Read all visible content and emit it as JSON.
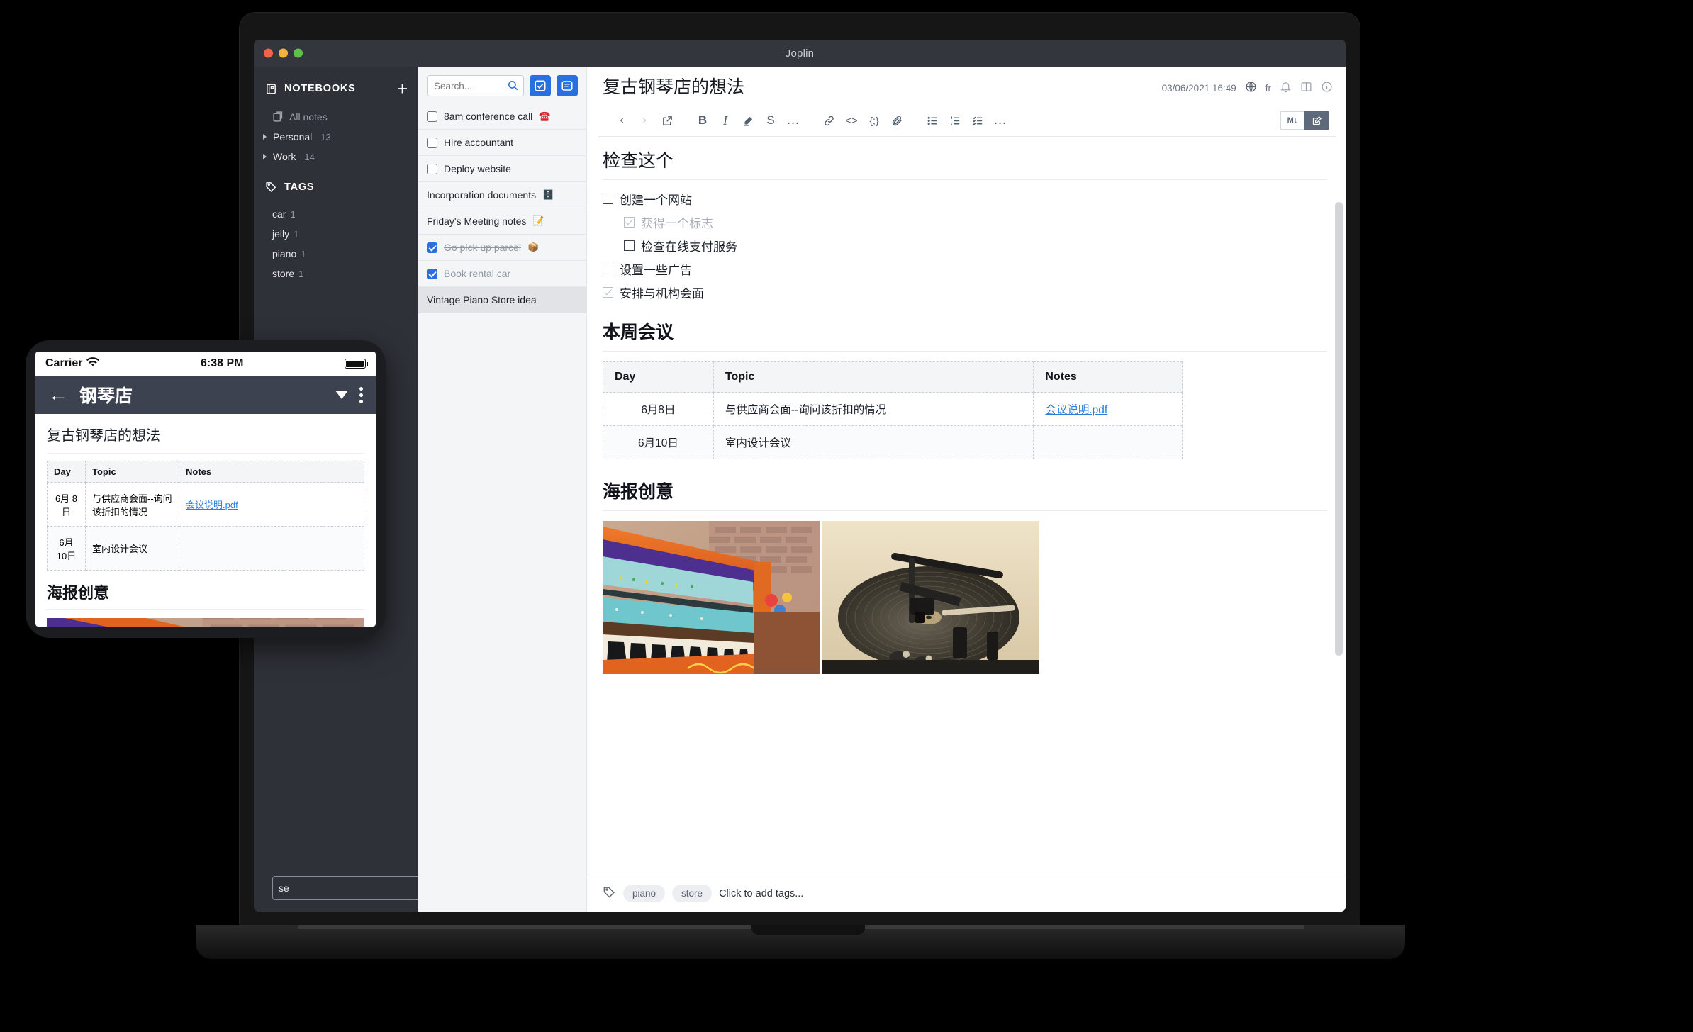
{
  "window": {
    "title": "Joplin"
  },
  "sidebar": {
    "notebooks_header": "NOTEBOOKS",
    "add_label": "+",
    "all_notes": "All notes",
    "notebooks": [
      {
        "label": "Personal",
        "count": "13"
      },
      {
        "label": "Work",
        "count": "14"
      }
    ],
    "tags_header": "TAGS",
    "tags": [
      {
        "label": "car",
        "count": "1"
      },
      {
        "label": "jelly",
        "count": "1"
      },
      {
        "label": "piano",
        "count": "1"
      },
      {
        "label": "store",
        "count": "1"
      }
    ],
    "bottom_input_value": "se"
  },
  "notelist": {
    "search_placeholder": "Search...",
    "search_value": "",
    "new_todo_label": "new-todo-button",
    "new_note_label": "new-note-button",
    "items": [
      {
        "title": "8am conference call",
        "emoji": "☎️",
        "type": "todo",
        "checked": false,
        "done": false,
        "selected": false
      },
      {
        "title": "Hire accountant",
        "emoji": "",
        "type": "todo",
        "checked": false,
        "done": false,
        "selected": false
      },
      {
        "title": "Deploy website",
        "emoji": "",
        "type": "todo",
        "checked": false,
        "done": false,
        "selected": false
      },
      {
        "title": "Incorporation documents",
        "emoji": "🗄️",
        "type": "note",
        "checked": false,
        "done": false,
        "selected": false
      },
      {
        "title": "Friday's Meeting notes",
        "emoji": "📝",
        "type": "note",
        "checked": false,
        "done": false,
        "selected": false
      },
      {
        "title": "Go pick up parcel",
        "emoji": "📦",
        "type": "todo",
        "checked": true,
        "done": true,
        "selected": false
      },
      {
        "title": "Book rental car",
        "emoji": "",
        "type": "todo",
        "checked": true,
        "done": true,
        "selected": false
      },
      {
        "title": "Vintage Piano Store idea",
        "emoji": "",
        "type": "note",
        "checked": false,
        "done": false,
        "selected": true
      }
    ]
  },
  "editor": {
    "note_title": "复古钢琴店的想法",
    "updated_at": "03/06/2021 16:49",
    "language_code": "fr",
    "toolbar": {
      "back": "‹",
      "forward": "›",
      "buttons": [
        {
          "name": "back-icon",
          "glyph": "‹"
        },
        {
          "name": "forward-icon",
          "glyph": "›"
        },
        {
          "name": "external-link-icon",
          "glyph": "↗"
        },
        {
          "name": "bold-icon",
          "glyph": "B"
        },
        {
          "name": "italic-icon",
          "glyph": "I"
        },
        {
          "name": "highlight-icon",
          "glyph": "✎"
        },
        {
          "name": "strikethrough-icon",
          "glyph": "S"
        },
        {
          "name": "more-format-icon",
          "glyph": "…"
        },
        {
          "name": "link-icon",
          "glyph": "🔗"
        },
        {
          "name": "inline-code-icon",
          "glyph": "<>"
        },
        {
          "name": "code-block-icon",
          "glyph": "{;}"
        },
        {
          "name": "attachment-icon",
          "glyph": "📎"
        },
        {
          "name": "bullet-list-icon",
          "glyph": "☰"
        },
        {
          "name": "numbered-list-icon",
          "glyph": "☰"
        },
        {
          "name": "checklist-icon",
          "glyph": "☰"
        },
        {
          "name": "more-tools-icon",
          "glyph": "…"
        }
      ],
      "markdown_toggle": "M↓",
      "editor_toggle": "✎"
    },
    "sections": {
      "checklist_heading": "检查这个",
      "checklist": [
        {
          "label": "创建一个网站",
          "checked": false,
          "indent": 0,
          "muted": false
        },
        {
          "label": "获得一个标志",
          "checked": true,
          "indent": 1,
          "muted": true
        },
        {
          "label": "检查在线支付服务",
          "checked": false,
          "indent": 1,
          "muted": false
        },
        {
          "label": "设置一些广告",
          "checked": false,
          "indent": 0,
          "muted": false
        },
        {
          "label": "安排与机构会面",
          "checked": true,
          "indent": 0,
          "muted": false
        }
      ],
      "meetings_heading": "本周会议",
      "table": {
        "headers": [
          "Day",
          "Topic",
          "Notes"
        ],
        "rows": [
          {
            "day": "6月8日",
            "topic": "与供应商会面--询问该折扣的情况",
            "notes": "会议说明.pdf",
            "notes_is_link": true
          },
          {
            "day": "6月10日",
            "topic": "室内设计会议",
            "notes": "",
            "notes_is_link": false
          }
        ]
      },
      "poster_heading": "海报创意",
      "images": [
        {
          "name": "colorful-painted-piano-photo"
        },
        {
          "name": "vinyl-turntable-photo"
        }
      ]
    },
    "tagbar": {
      "tags": [
        "piano",
        "store"
      ],
      "placeholder": "Click to add tags..."
    }
  },
  "phone": {
    "status": {
      "carrier": "Carrier",
      "time": "6:38 PM"
    },
    "appbar": {
      "back": "←",
      "title": "钢琴店"
    },
    "note_title": "复古钢琴店的想法",
    "table": {
      "headers": [
        "Day",
        "Topic",
        "Notes"
      ],
      "rows": [
        {
          "day": "6月\n8日",
          "topic": "与供应商会面--询问该折扣的情况",
          "notes": "会议说明.pdf",
          "notes_is_link": true
        },
        {
          "day": "6月\n10日",
          "topic": "室内设计会议",
          "notes": "",
          "notes_is_link": false
        }
      ]
    },
    "poster_heading": "海报创意",
    "image_name": "colorful-painted-piano-photo"
  },
  "colors": {
    "accent": "#2a6fe0",
    "sidebar_bg": "#2e3138",
    "titlebar_bg": "#33363c",
    "link": "#2a7ddb"
  }
}
